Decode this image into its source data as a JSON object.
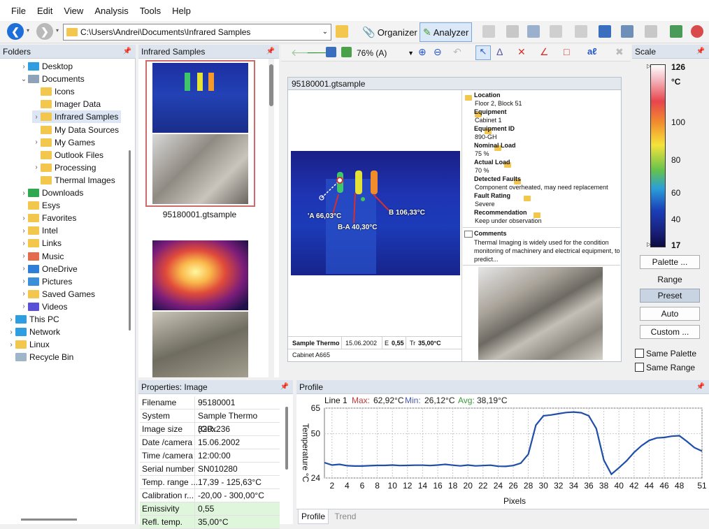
{
  "menu": [
    "File",
    "Edit",
    "View",
    "Analysis",
    "Tools",
    "Help"
  ],
  "address": {
    "path": "C:\\Users\\Andrei\\Documents\\Infrared Samples"
  },
  "toolbar": {
    "organizer": "Organizer",
    "analyzer": "Analyzer"
  },
  "folders_panel": {
    "title": "Folders"
  },
  "tree": [
    {
      "label": "Desktop",
      "indent": 1,
      "arrow": ">",
      "icon": "desktop-icon"
    },
    {
      "label": "Documents",
      "indent": 1,
      "arrow": "v",
      "icon": "documents-icon"
    },
    {
      "label": "Icons",
      "indent": 2,
      "arrow": "",
      "icon": "folder-icon"
    },
    {
      "label": "Imager Data",
      "indent": 2,
      "arrow": "",
      "icon": "folder-icon"
    },
    {
      "label": "Infrared Samples",
      "indent": 2,
      "arrow": ">",
      "icon": "folder-icon",
      "selected": true
    },
    {
      "label": "My Data Sources",
      "indent": 2,
      "arrow": "",
      "icon": "data-source-folder-icon"
    },
    {
      "label": "My Games",
      "indent": 2,
      "arrow": ">",
      "icon": "folder-icon"
    },
    {
      "label": "Outlook Files",
      "indent": 2,
      "arrow": "",
      "icon": "folder-icon"
    },
    {
      "label": "Processing",
      "indent": 2,
      "arrow": ">",
      "icon": "folder-icon"
    },
    {
      "label": "Thermal Images",
      "indent": 2,
      "arrow": "",
      "icon": "folder-icon"
    },
    {
      "label": "Downloads",
      "indent": 1,
      "arrow": ">",
      "icon": "downloads-icon"
    },
    {
      "label": "Esys",
      "indent": 1,
      "arrow": "",
      "icon": "folder-icon"
    },
    {
      "label": "Favorites",
      "indent": 1,
      "arrow": ">",
      "icon": "folder-icon"
    },
    {
      "label": "Intel",
      "indent": 1,
      "arrow": ">",
      "icon": "folder-icon"
    },
    {
      "label": "Links",
      "indent": 1,
      "arrow": ">",
      "icon": "folder-icon"
    },
    {
      "label": "Music",
      "indent": 1,
      "arrow": ">",
      "icon": "music-icon"
    },
    {
      "label": "OneDrive",
      "indent": 1,
      "arrow": ">",
      "icon": "onedrive-icon"
    },
    {
      "label": "Pictures",
      "indent": 1,
      "arrow": ">",
      "icon": "pictures-icon"
    },
    {
      "label": "Saved Games",
      "indent": 1,
      "arrow": ">",
      "icon": "folder-icon"
    },
    {
      "label": "Videos",
      "indent": 1,
      "arrow": ">",
      "icon": "videos-icon"
    },
    {
      "label": "This PC",
      "indent": 0,
      "arrow": ">",
      "icon": "computer-icon"
    },
    {
      "label": "Network",
      "indent": 0,
      "arrow": ">",
      "icon": "network-icon"
    },
    {
      "label": "Linux",
      "indent": 0,
      "arrow": ">",
      "icon": "folder-icon"
    },
    {
      "label": "Recycle Bin",
      "indent": 0,
      "arrow": "",
      "icon": "recycle-bin-icon"
    }
  ],
  "samples_panel": {
    "title": "Infrared Samples",
    "thumb1_label": "95180001.gtsample"
  },
  "viewer": {
    "zoom": "76% (A)"
  },
  "report": {
    "title": "95180001.gtsample",
    "markers": {
      "a": "'A 66,03°C",
      "b": "B 106,33°C",
      "ba": "B-A 40,30°C"
    },
    "fields": [
      {
        "label": "Location",
        "value": "Floor 2, Block 51"
      },
      {
        "label": "Equipment",
        "value": "Cabinet 1"
      },
      {
        "label": "Equipment ID",
        "value": "890-GH"
      },
      {
        "label": "Nominal Load",
        "value": "75 %"
      },
      {
        "label": "Actual Load",
        "value": "70 %"
      },
      {
        "label": "Detected Faults",
        "value": "Component overheated, may need replacement"
      },
      {
        "label": "Fault Rating",
        "value": "Severe"
      },
      {
        "label": "Recommendation",
        "value": "Keep under observation"
      }
    ],
    "comments_label": "Comments",
    "comments": "Thermal Imaging is widely used for the condition monitoring of machinery and electrical equipment, to predict...",
    "footer": {
      "camera": "Sample Thermo",
      "date": "15.06.2002",
      "e_label": "E",
      "e_value": "0,55",
      "tr_label": "Tr",
      "tr_value": "35,00°C",
      "caption": "Cabinet A665"
    }
  },
  "scale": {
    "title": "Scale",
    "max": "126",
    "unit": "°C",
    "ticks": [
      "100",
      "80",
      "60",
      "40"
    ],
    "min": "17",
    "palette_btn": "Palette ...",
    "range_label": "Range",
    "preset": "Preset",
    "auto": "Auto",
    "custom": "Custom ...",
    "same_palette": "Same Palette",
    "same_range": "Same Range"
  },
  "properties": {
    "title": "Properties: Image",
    "rows": [
      {
        "k": "Filename",
        "v": "95180001"
      },
      {
        "k": "System",
        "v": "Sample Thermo (GR..."
      },
      {
        "k": "Image size",
        "v": "320x236"
      },
      {
        "k": "Date /camera",
        "v": "15.06.2002"
      },
      {
        "k": "Time /camera",
        "v": "12:00:00"
      },
      {
        "k": "Serial number",
        "v": "SN010280"
      },
      {
        "k": "Temp. range ...",
        "v": "17,39 - 125,63°C"
      },
      {
        "k": "Calibration r...",
        "v": "-20,00 - 300,00°C"
      },
      {
        "k": "Emissivity",
        "v": "0,55",
        "highlight": true
      },
      {
        "k": "Refl. temp.",
        "v": "35,00°C",
        "highlight": true
      }
    ]
  },
  "profile_panel": {
    "title": "Profile",
    "tab_profile": "Profile",
    "tab_trend": "Trend"
  },
  "chart_data": {
    "type": "line",
    "title": "Line 1",
    "stats": {
      "max_label": "Max:",
      "max": "62,92°C",
      "min_label": "Min:",
      "min": "26,12°C",
      "avg_label": "Avg:",
      "avg": "38,19°C"
    },
    "xlabel": "Pixels",
    "ylabel": "Temperature °C",
    "xlim": [
      1,
      51
    ],
    "ylim": [
      24,
      65
    ],
    "xticks": [
      2,
      4,
      6,
      8,
      10,
      12,
      14,
      16,
      18,
      20,
      22,
      24,
      26,
      28,
      30,
      32,
      34,
      36,
      38,
      40,
      42,
      44,
      46,
      48,
      51
    ],
    "yticks": [
      24,
      50,
      65
    ],
    "x": [
      1,
      2,
      3,
      4,
      5,
      6,
      7,
      8,
      9,
      10,
      11,
      12,
      13,
      14,
      15,
      16,
      17,
      18,
      19,
      20,
      21,
      22,
      23,
      24,
      25,
      26,
      27,
      28,
      29,
      30,
      31,
      32,
      33,
      34,
      35,
      36,
      37,
      38,
      39,
      40,
      41,
      42,
      43,
      44,
      45,
      46,
      47,
      48,
      49,
      50,
      51
    ],
    "values": [
      33,
      31.6,
      32,
      31.2,
      31,
      31,
      31.2,
      31.4,
      31.4,
      31.6,
      31.3,
      31.4,
      31.5,
      31.5,
      31.3,
      31.6,
      32,
      31.5,
      31.1,
      31.6,
      31.1,
      31.3,
      31.5,
      30.9,
      30.8,
      31.3,
      32.7,
      38,
      55,
      60.5,
      61,
      61.7,
      62.4,
      62.7,
      62.3,
      60.5,
      53,
      34.5,
      26.2,
      30,
      34,
      39,
      43,
      46,
      47.5,
      47.8,
      48.5,
      48.8,
      45.5,
      41.8,
      39.8
    ],
    "grid": true
  }
}
